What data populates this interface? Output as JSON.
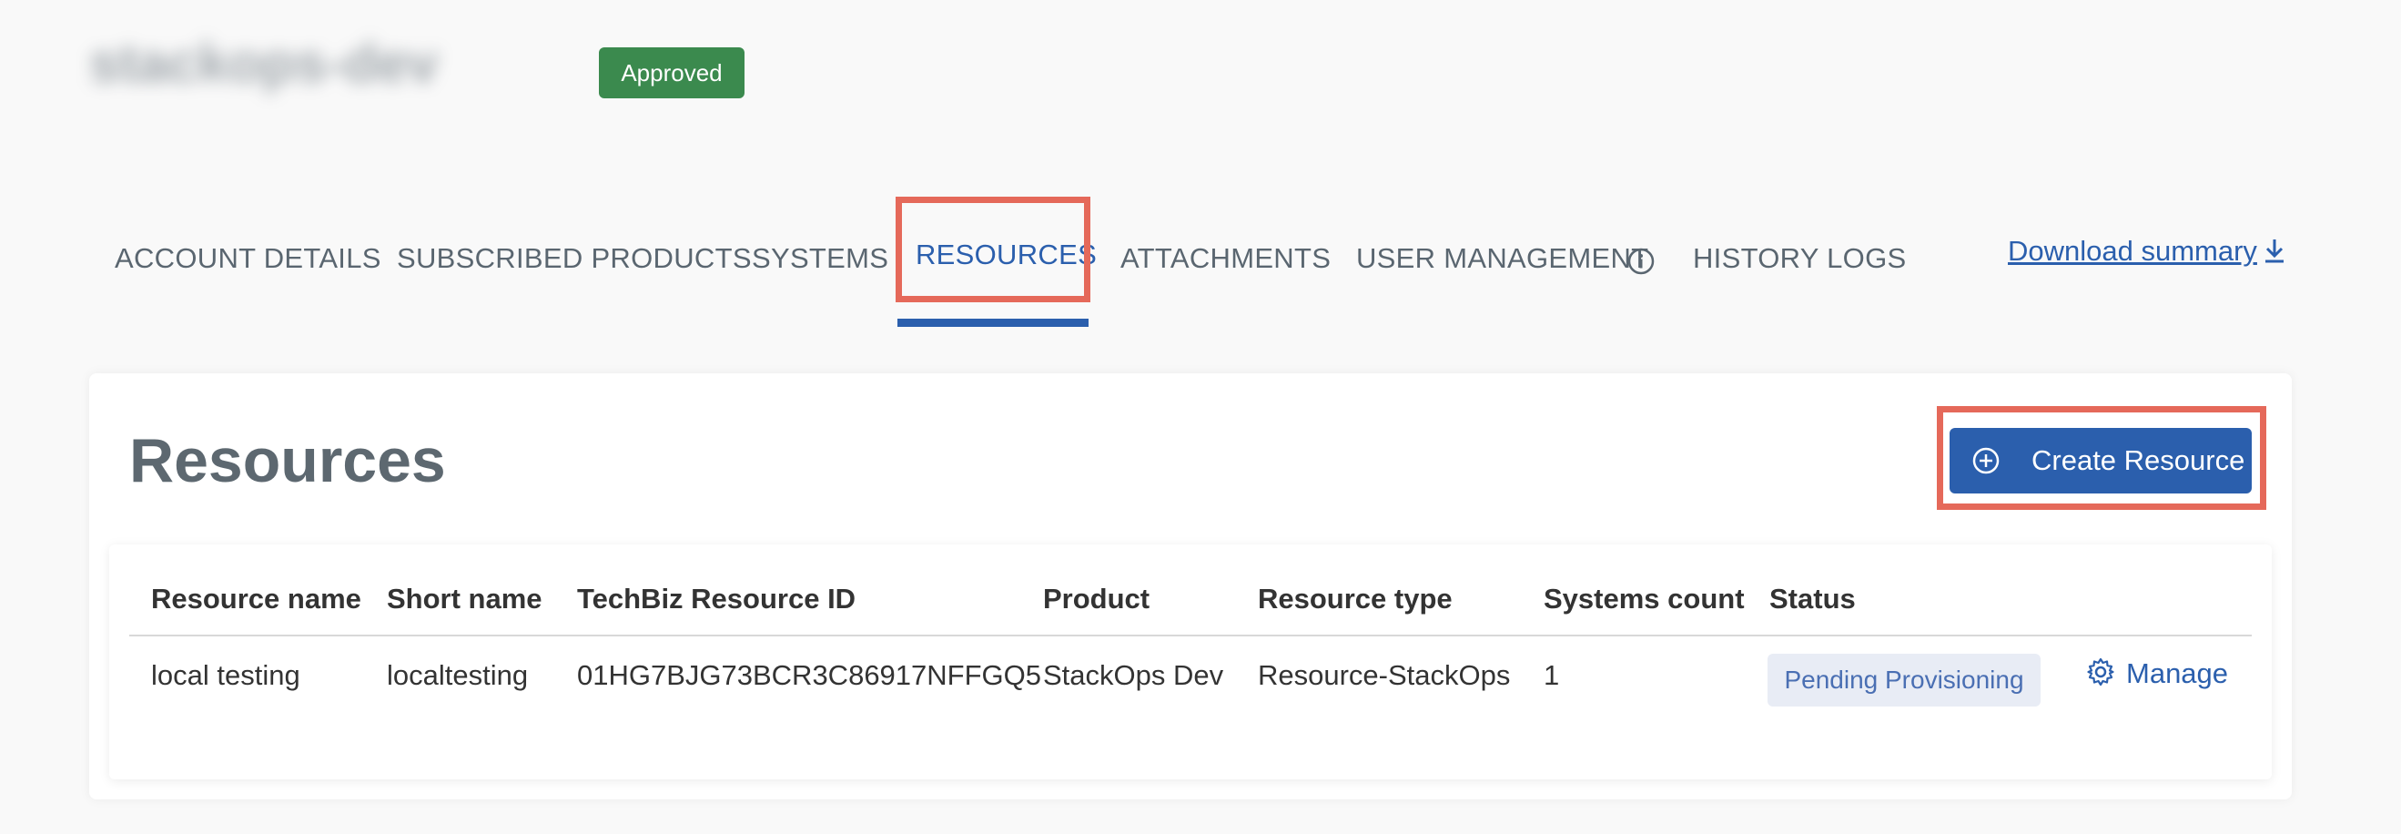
{
  "account": {
    "title": "stackops-dev",
    "status_badge": "Approved"
  },
  "tabs": [
    {
      "label": "ACCOUNT DETAILS"
    },
    {
      "label": "SUBSCRIBED PRODUCTS"
    },
    {
      "label": "SYSTEMS"
    },
    {
      "label": "RESOURCES",
      "active": true
    },
    {
      "label": "ATTACHMENTS"
    },
    {
      "label": "USER MANAGEMENT"
    },
    {
      "label": "HISTORY LOGS"
    }
  ],
  "download_summary_label": "Download summary",
  "main": {
    "heading": "Resources",
    "create_button_label": "Create Resource"
  },
  "table": {
    "columns": [
      "Resource name",
      "Short name",
      "TechBiz Resource ID",
      "Product",
      "Resource type",
      "Systems count",
      "Status"
    ],
    "rows": [
      {
        "resource_name": "local testing",
        "short_name": "localtesting",
        "resource_id": "01HG7BJG73BCR3C86917NFFGQ5",
        "product": "StackOps Dev",
        "resource_type": "Resource-StackOps",
        "systems_count": "1",
        "status": "Pending Provisioning",
        "action_label": "Manage"
      }
    ]
  },
  "colors": {
    "accent": "#2b5fad",
    "approved": "#3b8a4e",
    "highlight": "#e5695a",
    "heading": "#5d6870"
  },
  "icons": [
    "info-icon",
    "download-icon",
    "plus-circle-icon",
    "gear-icon"
  ]
}
